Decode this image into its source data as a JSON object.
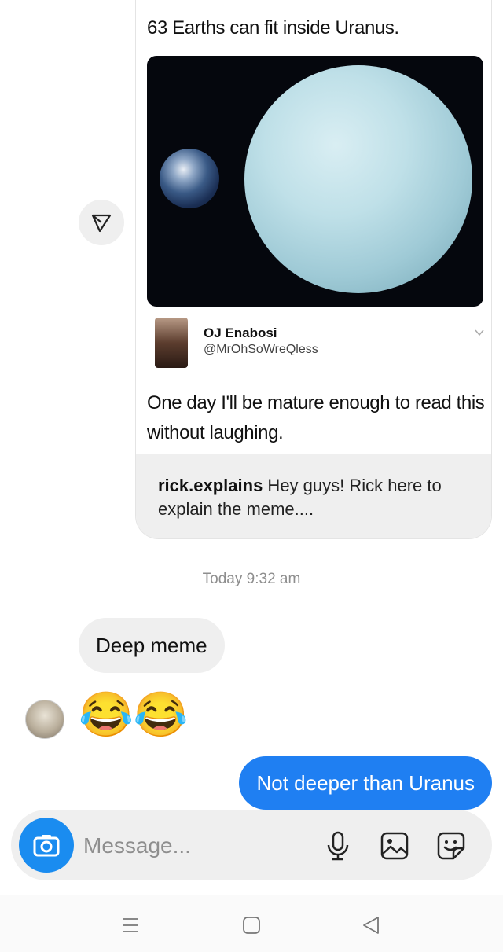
{
  "shared_post": {
    "tweet_text": "63 Earths can fit inside Uranus.",
    "author_name": "OJ Enabosi",
    "author_handle": "@MrOhSoWreQless",
    "body": "One day I'll be mature enough to read this without laughing.",
    "caption_user": "rick.explains",
    "caption_text": " Hey guys! Rick here to explain the meme...."
  },
  "timestamp": "Today 9:32 am",
  "messages": {
    "incoming_text": "Deep meme",
    "incoming_emoji": "😂😂",
    "outgoing_text": "Not deeper than Uranus"
  },
  "composer": {
    "placeholder": "Message..."
  },
  "icons": {
    "share": "paper-plane-icon",
    "chevron": "chevron-down-icon",
    "camera": "camera-icon",
    "microphone": "microphone-icon",
    "gallery": "gallery-icon",
    "sticker": "sticker-icon",
    "nav_menu": "menu-icon",
    "nav_home": "home-icon",
    "nav_back": "back-icon"
  },
  "colors": {
    "outgoing_bubble": "#1f7ff2",
    "camera_button": "#1a8cf0",
    "incoming_bubble": "#efefef",
    "timestamp": "#8e8e8e"
  }
}
